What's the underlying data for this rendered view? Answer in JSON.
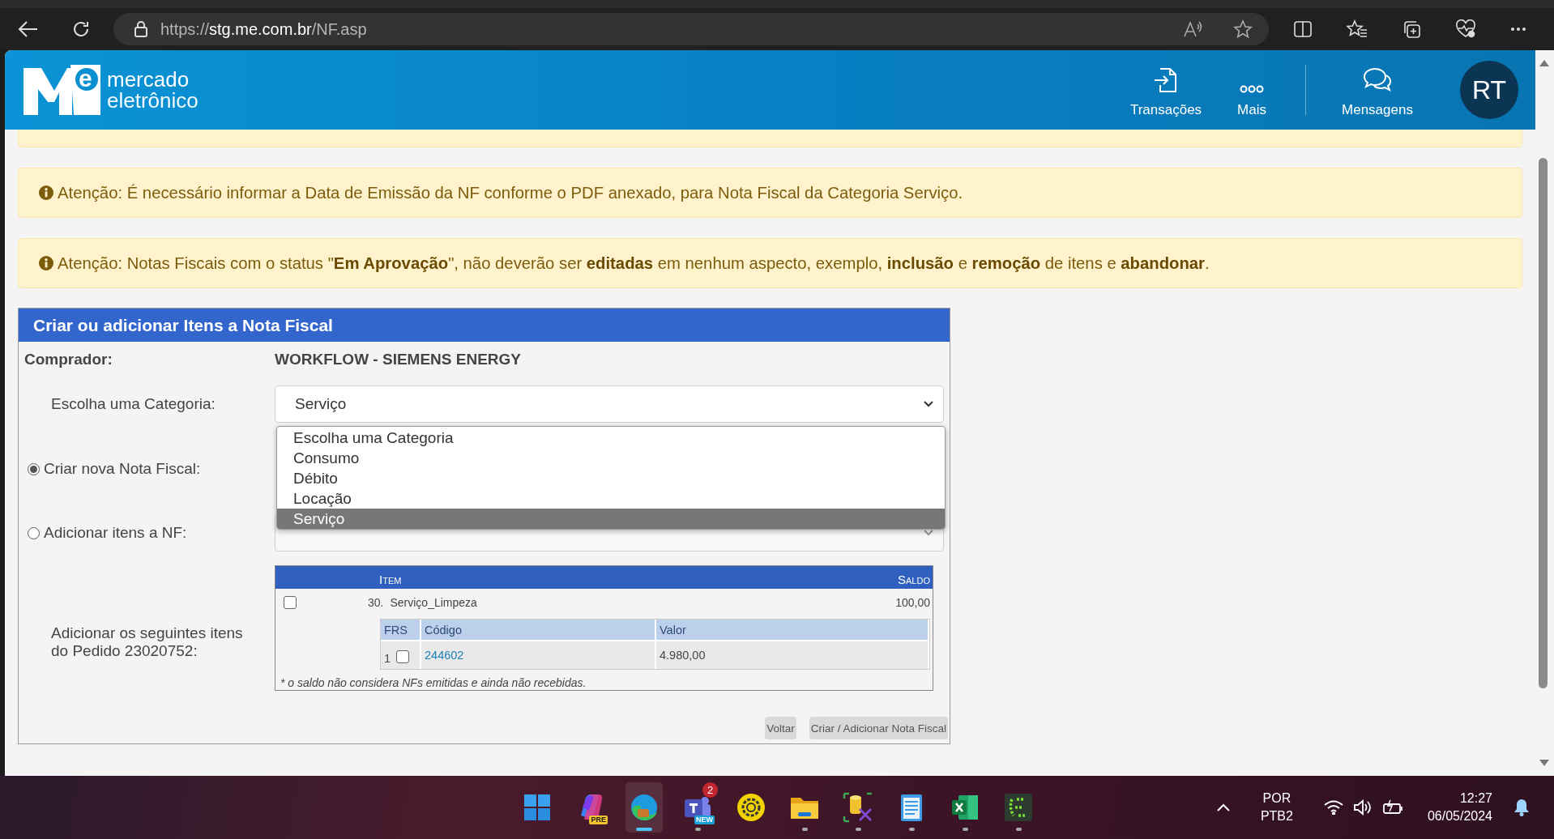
{
  "browser": {
    "url_scheme": "https://",
    "url_host": "stg.me.com.br",
    "url_path": "/NF.asp"
  },
  "header": {
    "logo_letter": "e",
    "logo_line_1": "mercado",
    "logo_line_2": "eletrônico",
    "avatar": "RT",
    "nav": [
      {
        "kind": "transactions",
        "label": "Transações"
      },
      {
        "kind": "more",
        "label": "Mais"
      },
      {
        "kind": "messages",
        "label": "Mensagens"
      }
    ]
  },
  "alerts": [
    {
      "text": "Atenção: É necessário informar a Data de Emissão da NF conforme o PDF anexado, para Nota Fiscal da Categoria Serviço."
    },
    {
      "text": "Atenção: Notas Fiscais com o status \"**Em Aprovação**\", não deverão ser **editadas** em nenhum aspecto, exemplo, **inclusão** e **remoção** de itens e **abandonar**."
    }
  ],
  "form": {
    "title": "Criar ou adicionar Itens a Nota Fiscal",
    "buyer_label": "Comprador:",
    "buyer": "WORKFLOW - SIEMENS ENERGY",
    "category_label": "Escolha uma Categoria:",
    "category_value": "Serviço",
    "category_options": [
      {
        "label": "Escolha uma Categoria",
        "selected": false
      },
      {
        "label": "Consumo",
        "selected": false
      },
      {
        "label": "Débito",
        "selected": false
      },
      {
        "label": "Locação",
        "selected": false
      },
      {
        "label": "Serviço",
        "selected": true
      }
    ],
    "modes": [
      {
        "label": "Criar nova Nota Fiscal:",
        "selected": true
      },
      {
        "label": "Adicionar itens a NF:",
        "selected": false
      }
    ],
    "items_label": "Adicionar os seguintes itens do Pedido 23020752:",
    "items_table": {
      "columns": [
        "Item",
        "Saldo"
      ],
      "sub_columns": [
        "FRS",
        "Código",
        "Valor"
      ],
      "rows": [
        {
          "checked": false,
          "number": "30.",
          "name": "Serviço_Limpeza",
          "balance": "100,00",
          "sub_rows": [
            {
              "frs": "1",
              "checked": false,
              "code": "244602",
              "value": "4.980,00"
            }
          ]
        }
      ],
      "footnote": "* o saldo não considera NFs emitidas e ainda não recebidas."
    },
    "buttons": [
      "Voltar",
      "Criar / Adicionar Nota Fiscal"
    ]
  },
  "taskbar": {
    "apps": [
      {
        "kind": "windows",
        "selected": false,
        "running": false
      },
      {
        "kind": "copilot",
        "selected": false,
        "running": false,
        "tag": "PRE"
      },
      {
        "kind": "edge",
        "selected": true,
        "running": true
      },
      {
        "kind": "teams",
        "selected": false,
        "running": true,
        "badge": "2",
        "tag": "NEW"
      },
      {
        "kind": "gear",
        "selected": false,
        "running": false
      },
      {
        "kind": "folder",
        "selected": false,
        "running": true
      },
      {
        "kind": "database",
        "selected": false,
        "running": true
      },
      {
        "kind": "notepad",
        "selected": false,
        "running": true
      },
      {
        "kind": "spreadsheet",
        "selected": false,
        "running": true
      },
      {
        "kind": "terminal",
        "selected": false,
        "running": true
      }
    ],
    "language": "POR",
    "layout": "PTB2",
    "time": "12:27",
    "date": "06/05/2024"
  }
}
